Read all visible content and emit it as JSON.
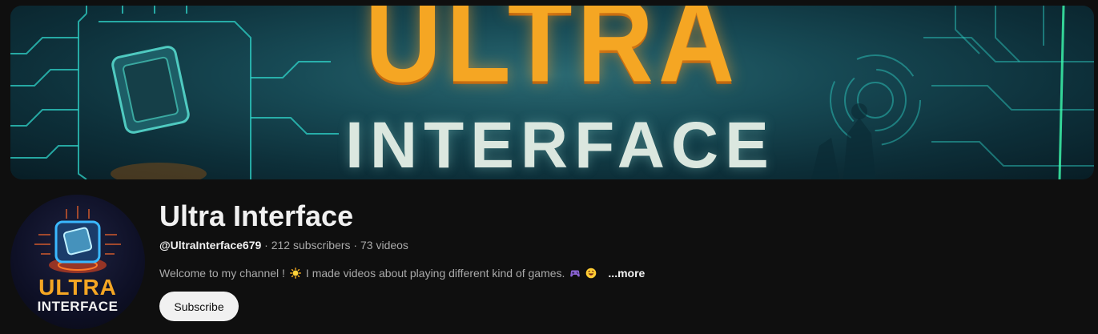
{
  "banner": {
    "title_line1": "ULTRA",
    "title_line2": "INTERFACE"
  },
  "avatar": {
    "line1": "ULTRA",
    "line2": "INTERFACE"
  },
  "channel": {
    "name": "Ultra Interface",
    "handle": "@UltraInterface679",
    "subscribers": "212 subscribers",
    "videos": "73 videos",
    "separator": " · "
  },
  "description": {
    "part1": "Welcome to my channel !",
    "part2": "I made videos about playing different kind of games.",
    "more": "...more",
    "emoji_icons": [
      "sun-icon",
      "game-controller-icon",
      "grinning-face-icon"
    ]
  },
  "actions": {
    "subscribe_label": "Subscribe"
  },
  "colors": {
    "background": "#0f0f0f",
    "text_primary": "#f1f1f1",
    "text_secondary": "#aaaaaa",
    "accent_orange": "#f5a623",
    "banner_teal": "#1b5560"
  }
}
